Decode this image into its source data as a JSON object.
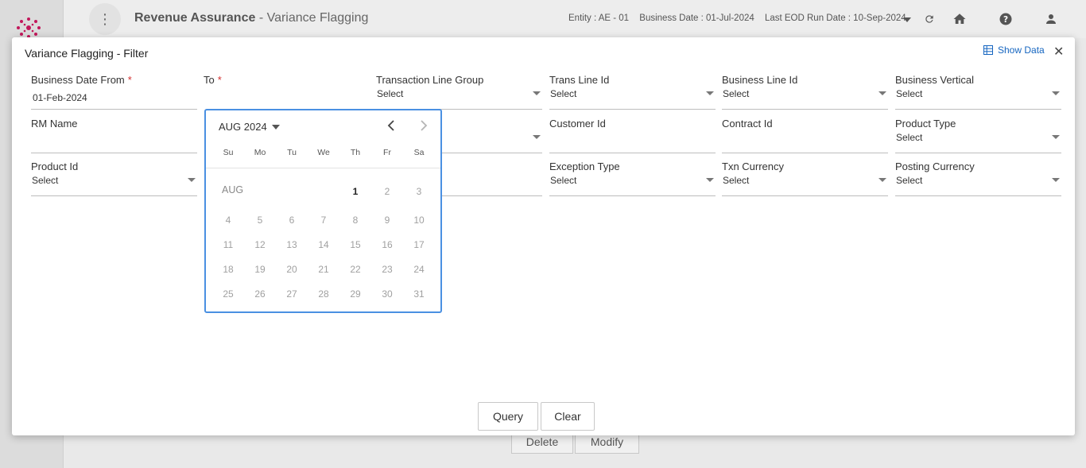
{
  "header": {
    "app_name": "Revenue Assurance",
    "page_name": " - Variance Flagging",
    "entity": "Entity : AE - 01",
    "business_date": "Business Date : 01-Jul-2024",
    "last_eod": "Last EOD Run Date : 10-Sep-2024"
  },
  "background_actions": {
    "delete": "Delete",
    "modify": "Modify"
  },
  "modal": {
    "title": "Variance Flagging - Filter",
    "show_data": "Show Data",
    "close": "✕",
    "fields": {
      "business_date_from": {
        "label": "Business Date From",
        "value": "01-Feb-2024"
      },
      "to": {
        "label": "To",
        "value": ""
      },
      "transaction_line_group": {
        "label": "Transaction Line Group",
        "value": "Select"
      },
      "trans_line_id": {
        "label": "Trans Line Id",
        "value": "Select"
      },
      "business_line_id": {
        "label": "Business Line Id",
        "value": "Select"
      },
      "business_vertical": {
        "label": "Business Vertical",
        "value": "Select"
      },
      "rm_name": {
        "label": "RM Name",
        "value": ""
      },
      "customer_id": {
        "label": "Customer Id",
        "value": ""
      },
      "contract_id": {
        "label": "Contract Id",
        "value": ""
      },
      "product_type": {
        "label": "Product Type",
        "value": "Select"
      },
      "product_id": {
        "label": "Product Id",
        "value": "Select"
      },
      "exception_type": {
        "label": "Exception Type",
        "value": "Select"
      },
      "txn_currency": {
        "label": "Txn Currency",
        "value": "Select"
      },
      "posting_currency": {
        "label": "Posting Currency",
        "value": "Select"
      }
    },
    "buttons": {
      "query": "Query",
      "clear": "Clear"
    }
  },
  "calendar": {
    "header": "AUG 2024",
    "month_label": "AUG",
    "weekdays": [
      "Su",
      "Mo",
      "Tu",
      "We",
      "Th",
      "Fr",
      "Sa"
    ],
    "first_weekday": 4,
    "days_in_month": 31,
    "active_days": [
      1
    ]
  }
}
